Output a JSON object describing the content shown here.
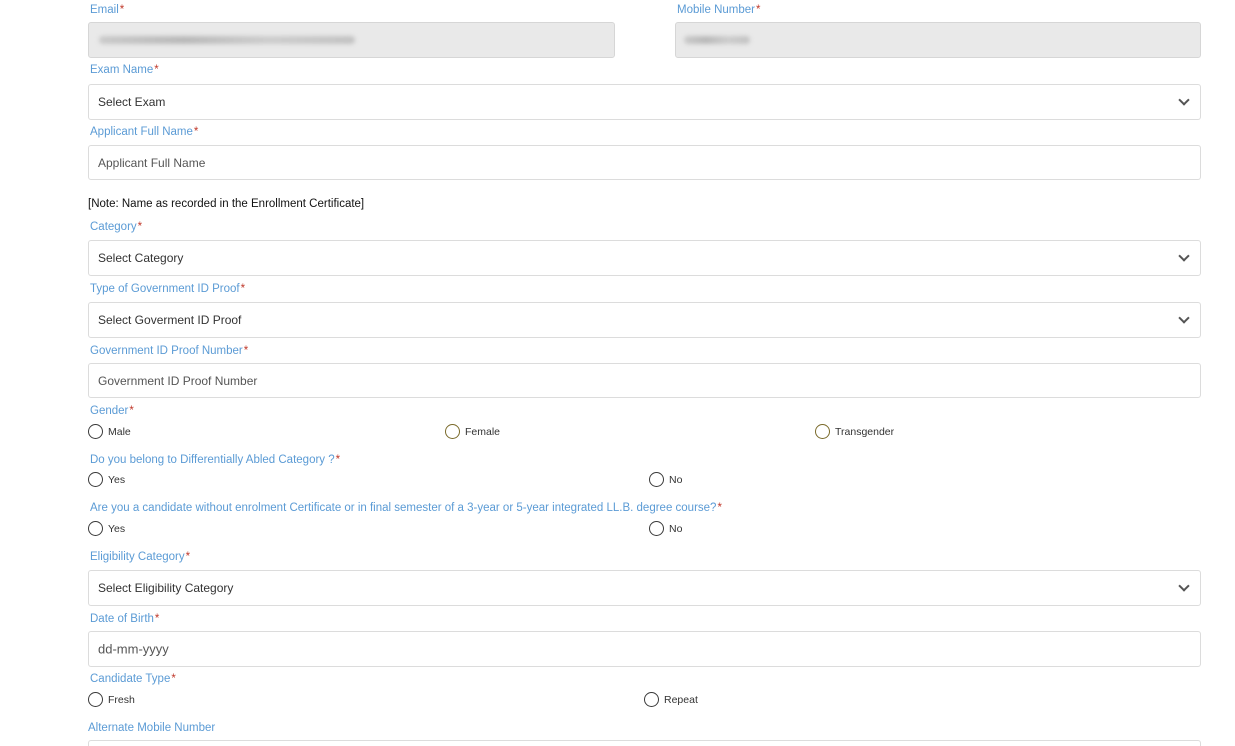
{
  "email": {
    "label": "Email",
    "required": "*"
  },
  "mobile": {
    "label": "Mobile Number",
    "required": "*"
  },
  "exam": {
    "label": "Exam Name",
    "required": "*",
    "value": "Select Exam"
  },
  "applicant": {
    "label": "Applicant Full Name",
    "required": "*",
    "placeholder": "Applicant Full Name"
  },
  "note": "[Note: Name as recorded in the Enrollment Certificate]",
  "category": {
    "label": "Category",
    "required": "*",
    "value": "Select Category"
  },
  "gov_id_type": {
    "label": "Type of Government ID Proof",
    "required": "*",
    "value": "Select Goverment ID Proof"
  },
  "gov_id_number": {
    "label": "Government ID Proof Number",
    "required": "*",
    "placeholder": "Government ID Proof Number"
  },
  "gender": {
    "label": "Gender",
    "required": "*",
    "options": [
      "Male",
      "Female",
      "Transgender"
    ]
  },
  "differently_abled": {
    "label": "Do you belong to Differentially Abled Category ?",
    "required": "*",
    "options": [
      "Yes",
      "No"
    ]
  },
  "enrolment": {
    "label": "Are you a candidate without enrolment Certificate or in final semester of a 3-year or 5-year integrated LL.B. degree course?",
    "required": "*",
    "options": [
      "Yes",
      "No"
    ]
  },
  "eligibility": {
    "label": "Eligibility Category",
    "required": "*",
    "value": "Select Eligibility Category"
  },
  "dob": {
    "label": "Date of Birth",
    "required": "*",
    "placeholder": "dd-mm-yyyy"
  },
  "candidate_type": {
    "label": "Candidate Type",
    "required": "*",
    "options": [
      "Fresh",
      "Repeat"
    ]
  },
  "alt_mobile": {
    "label": "Alternate Mobile Number"
  },
  "icons": {
    "dropdown": "chevron-down-icon",
    "radio": "radio-unchecked-icon"
  }
}
